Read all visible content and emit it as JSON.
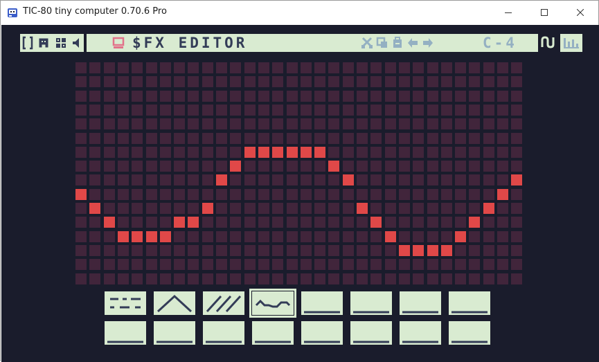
{
  "window": {
    "title": "TIC-80 tiny computer 0.70.6 Pro",
    "controls": [
      "minimize",
      "maximize",
      "close"
    ]
  },
  "toolbar": {
    "title": "$FX EDITOR",
    "note": "C-4",
    "left_icons": [
      "code-icon",
      "sprite-icon",
      "map-icon",
      "sound-icon",
      "music-icon",
      "sfx-icon"
    ],
    "right_icons": [
      "cut-icon",
      "copy-icon",
      "paste-icon",
      "undo-icon",
      "redo-icon"
    ],
    "mode_icons": [
      "wave-icon",
      "volume-bars-icon"
    ]
  },
  "editor": {
    "columns": 32,
    "rows": 16,
    "wave_rows": [
      9,
      10,
      11,
      12,
      12,
      12,
      12,
      11,
      11,
      10,
      8,
      7,
      6,
      6,
      6,
      6,
      6,
      6,
      7,
      8,
      10,
      11,
      12,
      13,
      13,
      13,
      13,
      12,
      11,
      10,
      9,
      8
    ]
  },
  "waveforms": {
    "selected": 3,
    "slots": [
      "square",
      "triangle",
      "sawtooth",
      "custom",
      "empty",
      "empty",
      "empty",
      "empty",
      "empty",
      "empty",
      "empty",
      "empty",
      "empty",
      "empty",
      "empty",
      "empty"
    ]
  },
  "colors": {
    "background": "#1a1c2c",
    "panel": "#d9ebd1",
    "cell_off": "#41253b",
    "cell_on": "#e04848",
    "ink": "#333c57"
  }
}
